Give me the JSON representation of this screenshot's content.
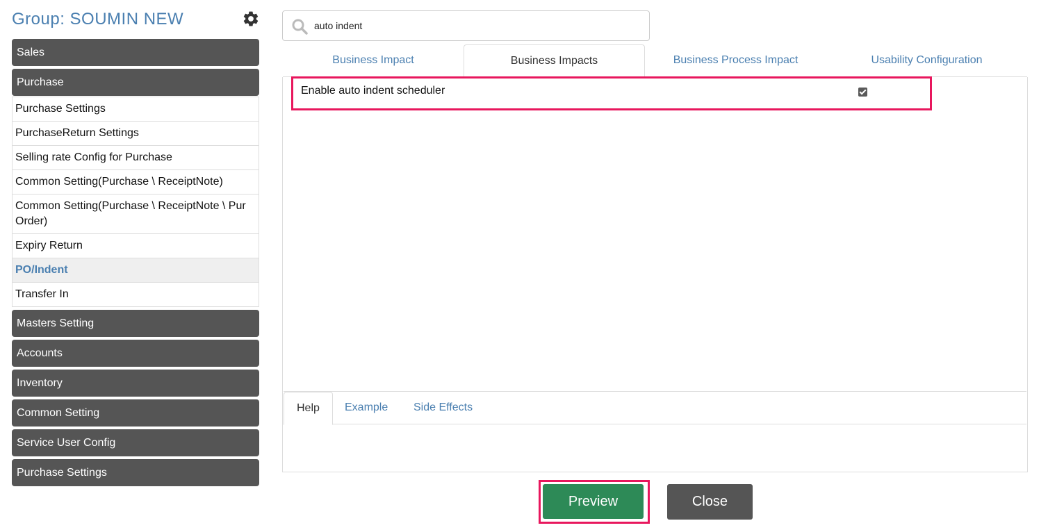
{
  "header": {
    "group_title": "Group: SOUMIN NEW",
    "settings_icon": "gear-icon"
  },
  "sidebar": {
    "sections": [
      {
        "label": "Sales"
      },
      {
        "label": "Purchase",
        "expanded": true,
        "items": [
          {
            "label": "Purchase Settings"
          },
          {
            "label": "PurchaseReturn Settings"
          },
          {
            "label": "Selling rate Config for Purchase"
          },
          {
            "label": "Common Setting(Purchase \\ ReceiptNote)"
          },
          {
            "label": "Common Setting(Purchase \\ ReceiptNote \\ Pur Order)"
          },
          {
            "label": "Expiry Return"
          },
          {
            "label": "PO/Indent",
            "active": true
          },
          {
            "label": "Transfer In"
          }
        ]
      },
      {
        "label": "Masters Setting"
      },
      {
        "label": "Accounts"
      },
      {
        "label": "Inventory"
      },
      {
        "label": "Common Setting"
      },
      {
        "label": "Service User Config"
      },
      {
        "label": "Purchase Settings"
      }
    ]
  },
  "search": {
    "value": "auto indent",
    "icon": "search-icon"
  },
  "tabs": [
    {
      "label": "Business Impact",
      "active": false
    },
    {
      "label": "Business Impacts",
      "active": true
    },
    {
      "label": "Business Process Impact",
      "active": false
    },
    {
      "label": "Usability Configuration",
      "active": false
    }
  ],
  "settings": [
    {
      "label": "Enable auto indent scheduler",
      "checked": true
    }
  ],
  "help_tabs": [
    {
      "label": "Help",
      "active": true
    },
    {
      "label": "Example",
      "active": false
    },
    {
      "label": "Side Effects",
      "active": false
    }
  ],
  "actions": {
    "preview_label": "Preview",
    "close_label": "Close"
  },
  "colors": {
    "accent_link": "#4a7fb0",
    "section_bg": "#555555",
    "preview_bg": "#2d8a57",
    "highlight": "#e8175d"
  }
}
